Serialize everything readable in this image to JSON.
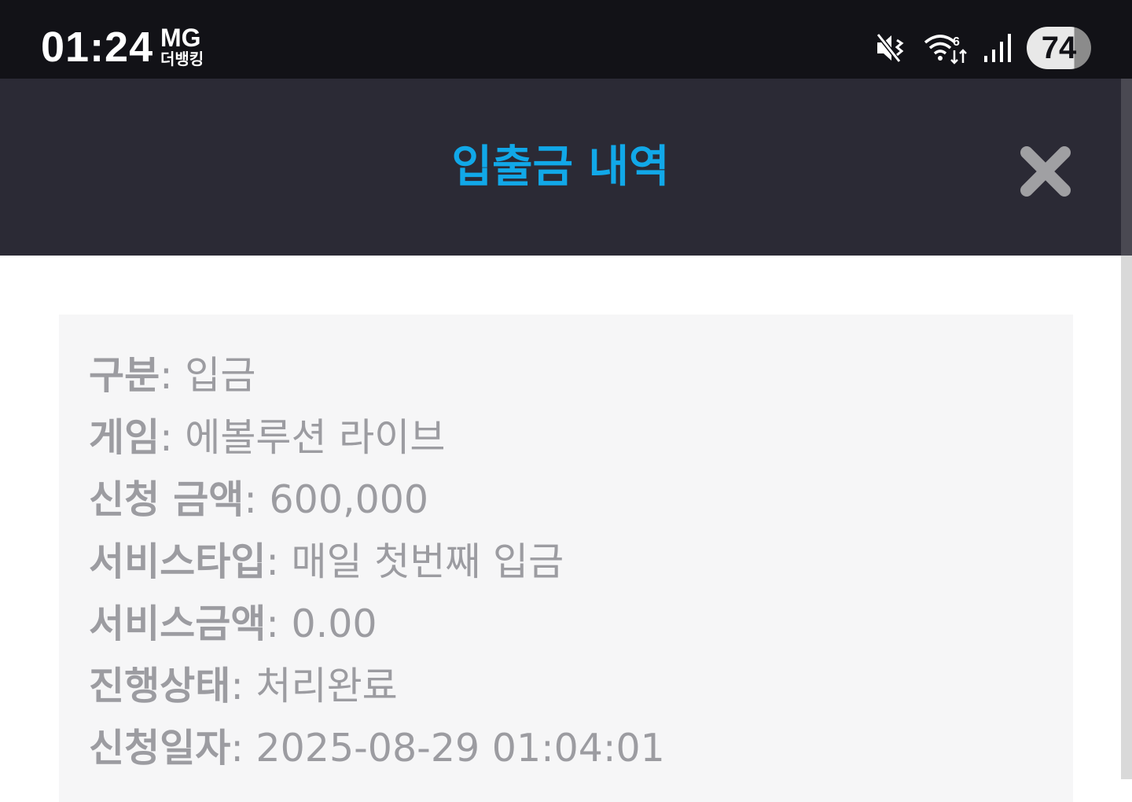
{
  "status_bar": {
    "time": "01:24",
    "carrier_brand": "MG",
    "carrier_sub": "더뱅킹",
    "battery": "74",
    "icons": [
      "mute-icon",
      "wifi-icon",
      "signal-icon",
      "battery-icon"
    ]
  },
  "header": {
    "title": "입출금 내역",
    "close_icon": "close-icon",
    "title_color": "#11a8e8",
    "bg_color": "#2b2a35"
  },
  "details": [
    {
      "label": "구분",
      "value": "입금"
    },
    {
      "label": "게임",
      "value": "에볼루션 라이브"
    },
    {
      "label": "신청 금액",
      "value": "600,000"
    },
    {
      "label": "서비스타입",
      "value": "매일 첫번째 입금"
    },
    {
      "label": "서비스금액",
      "value": "0.00"
    },
    {
      "label": "진행상태",
      "value": "처리완료"
    },
    {
      "label": "신청일자",
      "value": "2025-08-29 01:04:01"
    }
  ]
}
